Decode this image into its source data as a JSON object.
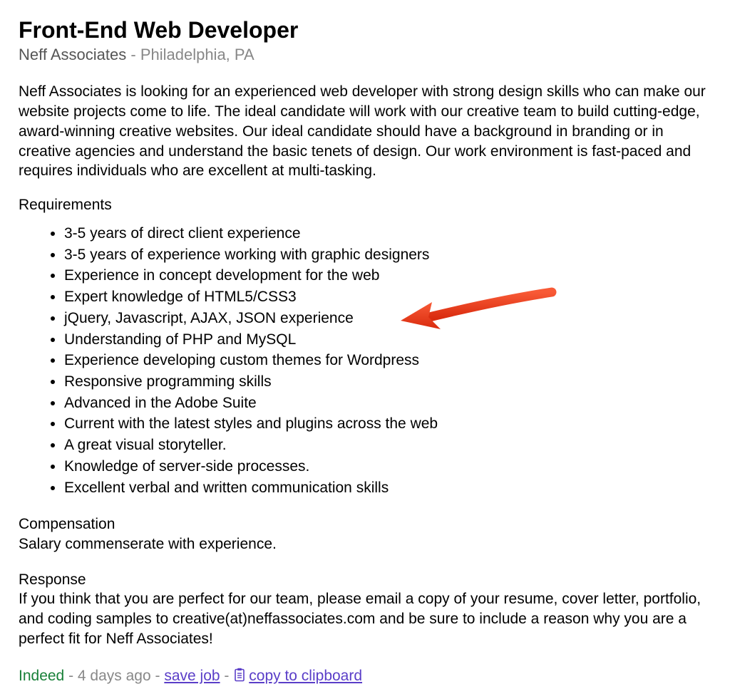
{
  "header": {
    "title": "Front-End Web Developer",
    "company": "Neff Associates",
    "separator": "-",
    "location": "Philadelphia, PA"
  },
  "intro": "Neff Associates is looking for an experienced web developer with strong design skills who can make our website projects come to life. The ideal candidate will work with our creative team to build cutting-edge, award-winning creative websites. Our ideal candidate should have a background in branding or in creative agencies and understand the basic tenets of design. Our work environment is fast-paced and requires individuals who are excellent at multi-tasking.",
  "requirements_heading": "Requirements",
  "requirements": [
    "3-5 years of direct client experience",
    "3-5 years of experience working with graphic designers",
    "Experience in concept development for the web",
    "Expert knowledge of HTML5/CSS3",
    "jQuery, Javascript, AJAX, JSON experience",
    "Understanding of PHP and MySQL",
    "Experience developing custom themes for Wordpress",
    "Responsive programming skills",
    "Advanced in the Adobe Suite",
    "Current with the latest styles and plugins across the web",
    "A great visual storyteller.",
    "Knowledge of server-side processes.",
    "Excellent verbal and written communication skills"
  ],
  "compensation": {
    "heading": "Compensation",
    "body": "Salary commenserate with experience."
  },
  "response": {
    "heading": "Response",
    "body": "If you think that you are perfect for our team, please email a copy of your resume, cover letter, portfolio, and coding samples to creative(at)neffassociates.com and be sure to include a reason why you are a perfect fit for Neff Associates!"
  },
  "footer": {
    "brand": "Indeed",
    "age": "4 days ago",
    "separator": "-",
    "save_label": "save job",
    "copy_label": "copy to clipboard"
  },
  "annotation": {
    "type": "arrow",
    "color": "#ee3f1d"
  }
}
